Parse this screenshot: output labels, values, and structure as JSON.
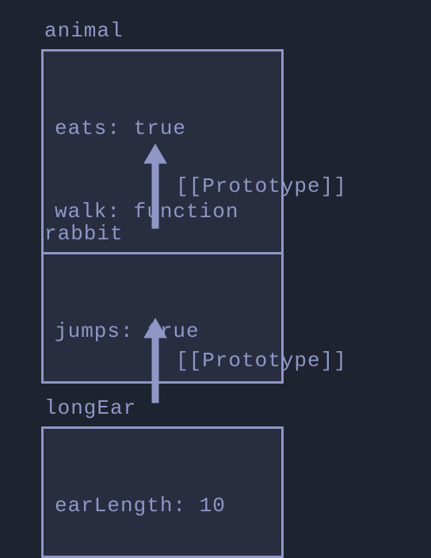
{
  "objects": {
    "animal": {
      "label": "animal",
      "props": [
        {
          "text": "eats: true"
        },
        {
          "text": "walk: function"
        }
      ]
    },
    "rabbit": {
      "label": "rabbit",
      "props": [
        {
          "text": "jumps: true"
        }
      ]
    },
    "longEar": {
      "label": "longEar",
      "props": [
        {
          "text": "earLength: 10"
        }
      ]
    }
  },
  "arrows": {
    "rabbit_to_animal": {
      "label": "[[Prototype]]"
    },
    "longEar_to_rabbit": {
      "label": "[[Prototype]]"
    }
  }
}
